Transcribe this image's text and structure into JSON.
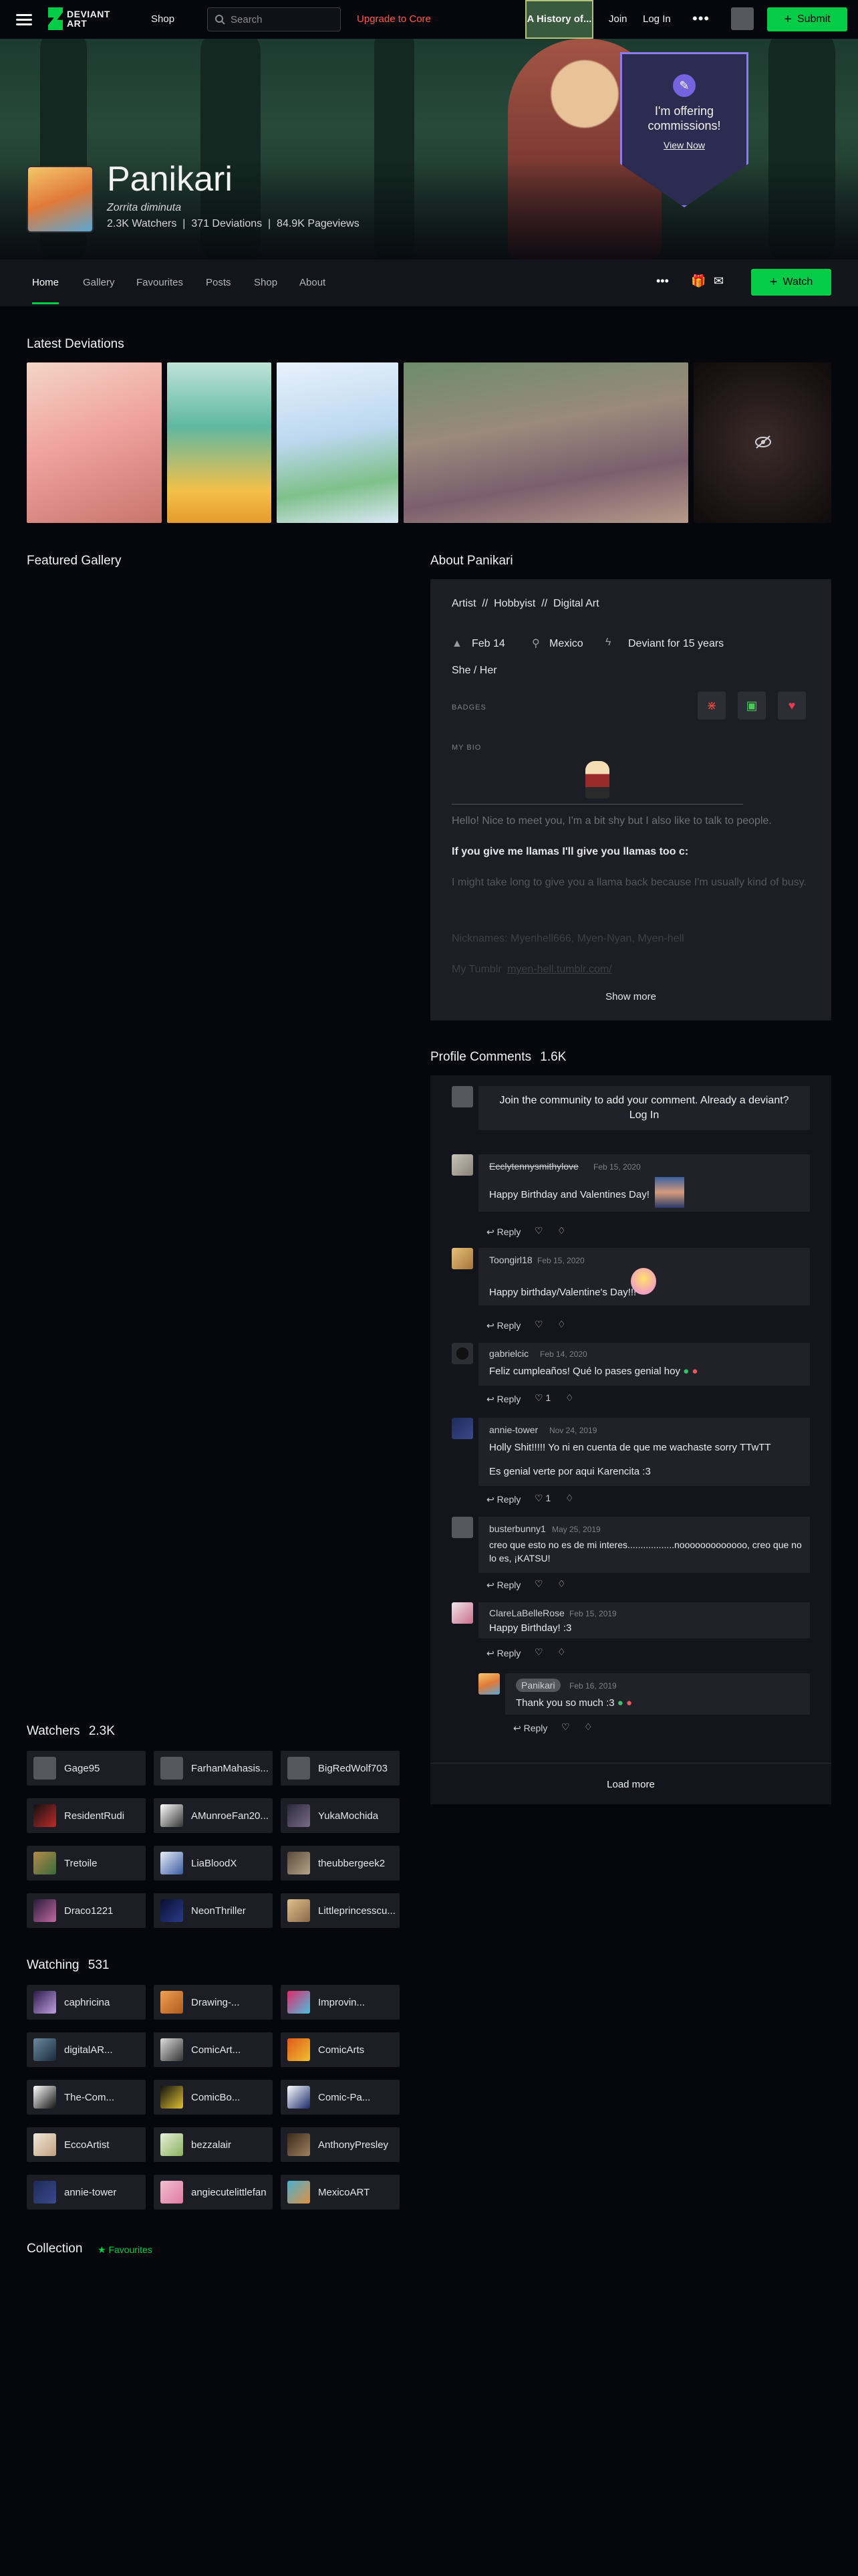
{
  "topbar": {
    "logo_text": "DEVIANT ART",
    "shop": "Shop",
    "search_placeholder": "Search",
    "upgrade": "Upgrade to Core",
    "promo": "A History of...",
    "join": "Join",
    "login": "Log In",
    "submit": "Submit"
  },
  "banner": {
    "badge_text": "I'm offering commissions!",
    "badge_link": "View Now"
  },
  "profile": {
    "name": "Panikari",
    "tagline": "Zorrita diminuta",
    "stats": "2.3K Watchers  |  371 Deviations  |  84.9K Pageviews"
  },
  "tabs": [
    "Home",
    "Gallery",
    "Favourites",
    "Posts",
    "Shop",
    "About"
  ],
  "watch_label": "Watch",
  "sections": {
    "latest": "Latest Deviations",
    "featured": "Featured Gallery",
    "about": "About Panikari",
    "comments": "Profile Comments",
    "comments_count": "1.6K",
    "watchers": "Watchers",
    "watchers_count": "2.3K",
    "watching": "Watching",
    "watching_count": "531",
    "collection": "Collection",
    "favourites": "Favourites"
  },
  "about": {
    "roles": "Artist  //  Hobbyist  //  Digital Art",
    "birthday": "Feb 14",
    "location": "Mexico",
    "member": "Deviant for 15 years",
    "pronouns": "She / Her",
    "badges_label": "BADGES",
    "bio_label": "MY BIO",
    "bio_1": "Hello! Nice to meet you, I'm a bit shy but I also like to talk to people.",
    "bio_2": "If you give me llamas I'll give you llamas too c:",
    "bio_3": "I might take long to give you a llama back because I'm usually kind of busy.",
    "bio_4": "Nicknames: Myenhell666, Myen-Nyan, Myen-hell",
    "bio_5": "My Tumblr",
    "bio_5_link": "myen-hell.tumblr.com/",
    "show_more": "Show more"
  },
  "comment_prompt": "Join the community to add your comment. Already a deviant? Log In",
  "comments": [
    {
      "user": "Ecclytennysmithylove",
      "date": "Feb 15, 2020",
      "text": "Happy Birthday and Valentines Day!",
      "likes": ""
    },
    {
      "user": "Toongirl18",
      "date": "Feb 15, 2020",
      "text": "Happy birthday/Valentine's Day!!!",
      "likes": ""
    },
    {
      "user": "gabrielcic",
      "date": "Feb 14, 2020",
      "text": "Feliz cumpleaños! Qué lo pases genial hoy",
      "likes": "1"
    },
    {
      "user": "annie-tower",
      "date": "Nov 24, 2019",
      "text": "Holly Shit!!!!! Yo ni en cuenta de que me wachaste sorry TTwTT",
      "text2": "Es genial verte por aqui Karencita :3",
      "likes": "1"
    },
    {
      "user": "busterbunny1",
      "date": "May 25, 2019",
      "text": "creo que esto no es de mi interes..................nooooooooooooo, creo que no lo es, ¡KATSU!",
      "likes": ""
    },
    {
      "user": "ClareLaBelleRose",
      "date": "Feb 15, 2019",
      "text": "Happy Birthday! :3",
      "likes": ""
    },
    {
      "user": "Panikari",
      "date": "Feb 16, 2019",
      "text": "Thank you so much :3",
      "likes": ""
    }
  ],
  "reply_label": "Reply",
  "load_more": "Load more",
  "watchers": [
    "Gage95",
    "FarhanMahasis...",
    "BigRedWolf703",
    "ResidentRudi",
    "AMunroeFan20...",
    "YukaMochida",
    "Tretoile",
    "LiaBloodX",
    "theubbergeek2",
    "Draco1221",
    "NeonThriller",
    "Littleprincesscu..."
  ],
  "watching": [
    "caphricina",
    "Drawing-...",
    "Improvin...",
    "digitalAR...",
    "ComicArt...",
    "ComicArts",
    "The-Com...",
    "ComicBo...",
    "Comic-Pa...",
    "EccoArtist",
    "bezzalair",
    "AnthonyPresley",
    "annie-tower",
    "angiecutelittlefan",
    "MexicoART"
  ]
}
